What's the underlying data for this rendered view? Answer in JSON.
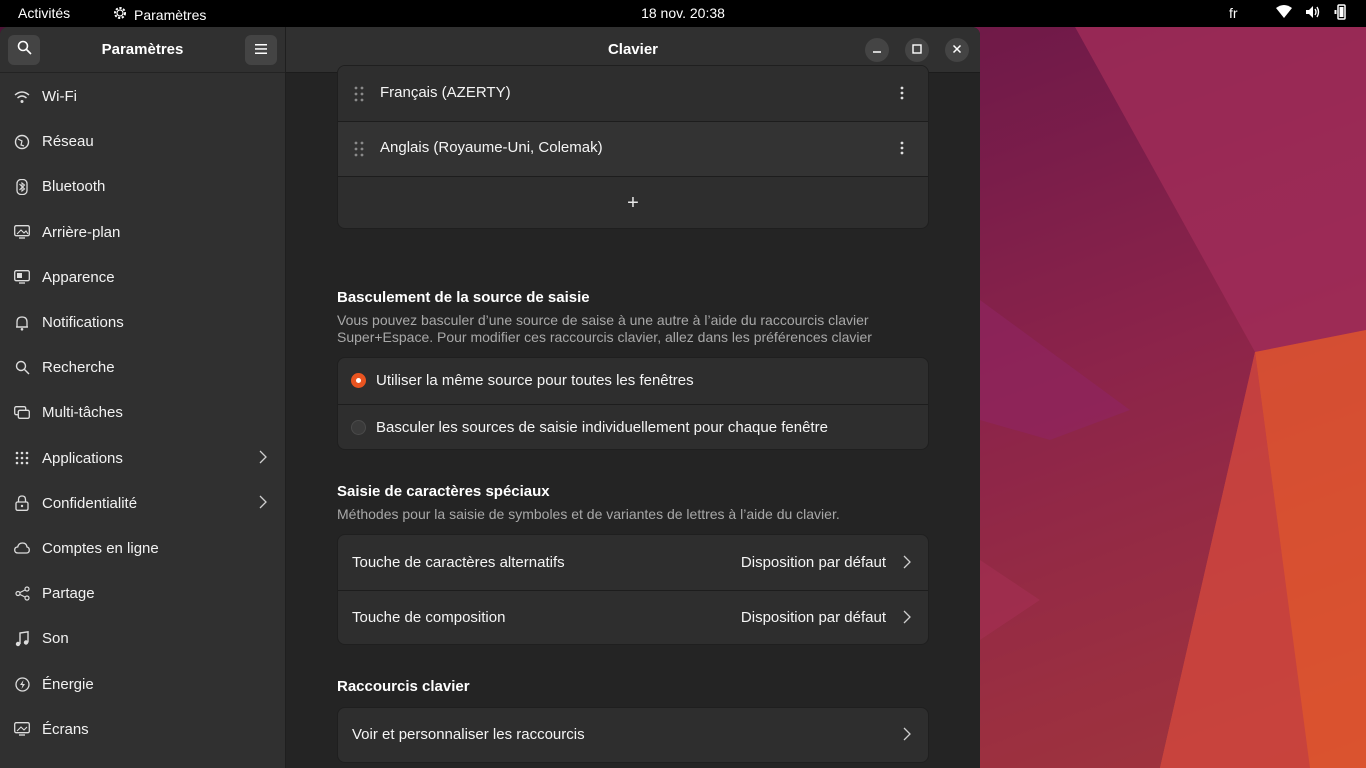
{
  "topbar": {
    "activities": "Activités",
    "app_name": "Paramètres",
    "clock": "18 nov.  20:38",
    "lang": "fr"
  },
  "sidebar": {
    "title": "Paramètres",
    "items": [
      {
        "label": "Wi-Fi",
        "icon": "wifi-icon"
      },
      {
        "label": "Réseau",
        "icon": "network-icon"
      },
      {
        "label": "Bluetooth",
        "icon": "bluetooth-icon"
      },
      {
        "label": "Arrière-plan",
        "icon": "background-icon"
      },
      {
        "label": "Apparence",
        "icon": "appearance-icon"
      },
      {
        "label": "Notifications",
        "icon": "bell-icon"
      },
      {
        "label": "Recherche",
        "icon": "search-icon"
      },
      {
        "label": "Multi-tâches",
        "icon": "multitasking-icon"
      },
      {
        "label": "Applications",
        "icon": "apps-grid-icon"
      },
      {
        "label": "Confidentialité",
        "icon": "lock-icon"
      },
      {
        "label": "Comptes en ligne",
        "icon": "cloud-icon"
      },
      {
        "label": "Partage",
        "icon": "share-icon"
      },
      {
        "label": "Son",
        "icon": "music-note-icon"
      },
      {
        "label": "Énergie",
        "icon": "power-icon"
      },
      {
        "label": "Écrans",
        "icon": "display-icon"
      }
    ]
  },
  "main": {
    "title": "Clavier",
    "input_sources": [
      {
        "label": "Français (AZERTY)"
      },
      {
        "label": "Anglais (Royaume-Uni, Colemak)"
      }
    ],
    "add_label": "+",
    "switching": {
      "title": "Basculement de la source de saisie",
      "desc_line1": "Vous pouvez basculer d’une source de saise à une autre à l’aide du raccourcis clavier",
      "desc_line2": "Super+Espace. Pour modifier ces raccourcis clavier, allez dans les préférences clavier",
      "options": [
        {
          "label": "Utiliser la même source pour toutes les fenêtres",
          "selected": true
        },
        {
          "label": "Basculer les sources de saisie individuellement pour chaque fenêtre",
          "selected": false
        }
      ]
    },
    "special": {
      "title": "Saisie de caractères spéciaux",
      "desc": "Méthodes pour la saisie de symboles et de variantes de lettres à l’aide du clavier.",
      "rows": [
        {
          "label": "Touche de caractères alternatifs",
          "value": "Disposition par défaut"
        },
        {
          "label": "Touche de composition",
          "value": "Disposition par défaut"
        }
      ]
    },
    "shortcuts": {
      "title": "Raccourcis clavier",
      "row_label": "Voir et personnaliser les raccourcis"
    }
  },
  "colors": {
    "accent": "#e95420",
    "sidebar_bg": "#303030",
    "content_bg": "#242424",
    "card_bg": "#2e2e2e"
  }
}
